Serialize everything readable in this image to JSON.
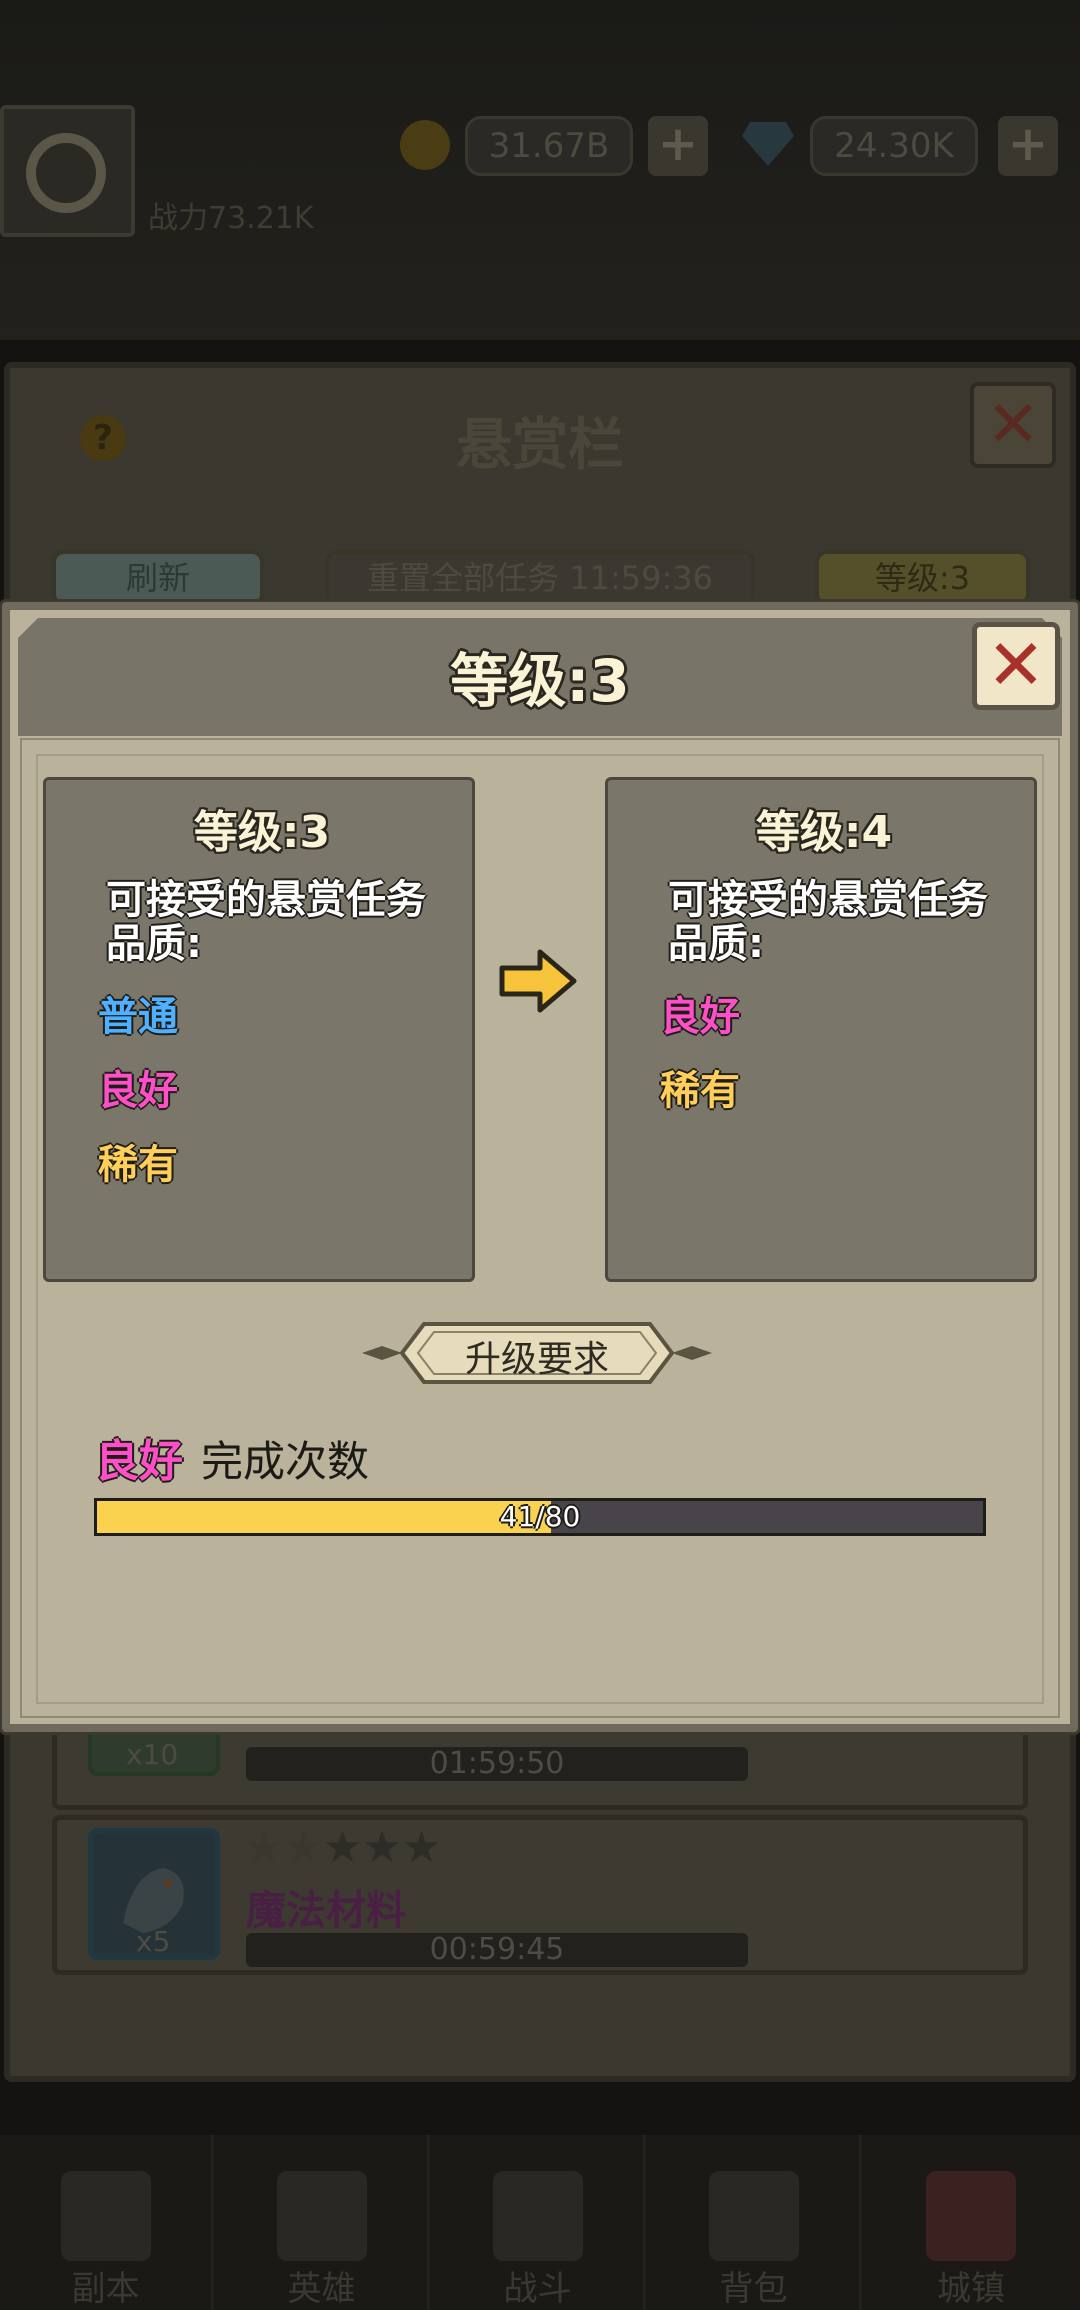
{
  "header": {
    "player_name": "",
    "gold_amount": "31.67B",
    "gem_amount": "24.30K",
    "plus_label": "+",
    "combat_power": "战力73.21K"
  },
  "bounty_board": {
    "title": "悬赏栏",
    "help_label": "?",
    "close_label": "✕",
    "refresh_label": "刷新",
    "reset_label": "重置全部任务 11:59:36",
    "level_label": "等级:3",
    "rows": [
      {
        "qty": "x10",
        "timer": "01:59:50"
      },
      {
        "qty": "x5",
        "timer": "00:59:45",
        "reward": "魔法材料",
        "stars_filled": 2,
        "stars_total": 5
      }
    ]
  },
  "modal": {
    "title": "等级:3",
    "close_label": "✕",
    "current": {
      "title": "等级:3",
      "desc": "可接受的悬赏任务品质:",
      "qualities": [
        {
          "label": "普通",
          "color": "#4fb0ff"
        },
        {
          "label": "良好",
          "color": "#ff4fc8"
        },
        {
          "label": "稀有",
          "color": "#ffcf5a"
        }
      ]
    },
    "next": {
      "title": "等级:4",
      "desc": "可接受的悬赏任务品质:",
      "qualities": [
        {
          "label": "良好",
          "color": "#ff4fc8"
        },
        {
          "label": "稀有",
          "color": "#ffcf5a"
        }
      ]
    },
    "arrow_icon": "right-arrow-icon",
    "requirement": {
      "banner": "升级要求",
      "quality": "良好",
      "quality_color": "#ff4fc8",
      "label": "完成次数",
      "current": 41,
      "target": 80,
      "progress_text": "41/80"
    }
  },
  "navbar": {
    "items": [
      "副本",
      "英雄",
      "战斗",
      "背包",
      "城镇"
    ]
  }
}
